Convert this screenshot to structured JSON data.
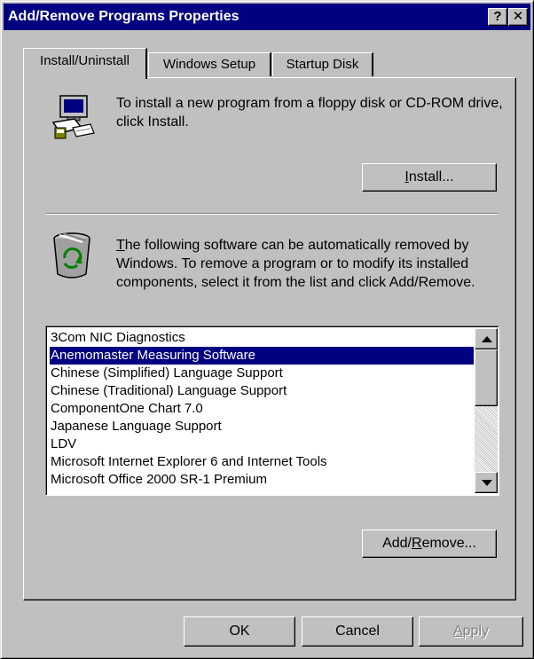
{
  "window": {
    "title": "Add/Remove Programs Properties",
    "help_glyph": "?",
    "close_glyph": "✕"
  },
  "tabs": [
    {
      "label": "Install/Uninstall",
      "active": true
    },
    {
      "label": "Windows Setup",
      "active": false
    },
    {
      "label": "Startup Disk",
      "active": false
    }
  ],
  "install_section": {
    "icon": "setup-program-icon",
    "text": "To install a new program from a floppy disk or CD-ROM drive, click Install.",
    "button": {
      "prefix": "",
      "mnemonic": "I",
      "suffix": "nstall..."
    }
  },
  "remove_section": {
    "icon": "recycle-bin-icon",
    "text_mnemonic": "T",
    "text_rest": "he following software can be automatically removed by Windows. To remove a program or to modify its installed components, select it from the list and click Add/Remove.",
    "list": {
      "items": [
        "3Com NIC Diagnostics",
        "Anemomaster Measuring Software",
        "Chinese (Simplified) Language Support",
        "Chinese (Traditional) Language Support",
        "ComponentOne Chart 7.0",
        "Japanese Language Support",
        "LDV",
        "Microsoft Internet Explorer 6 and Internet Tools",
        "Microsoft Office 2000 SR-1 Premium"
      ],
      "selected_index": 1
    },
    "button": {
      "prefix": "Add/",
      "mnemonic": "R",
      "suffix": "emove..."
    }
  },
  "footer": {
    "ok": "OK",
    "cancel": "Cancel",
    "apply_mnemonic": "A",
    "apply_rest": "pply"
  },
  "colors": {
    "face": "#c0c0c0",
    "titlebar": "#000080",
    "selection": "#000080",
    "disabled_text": "#808080"
  }
}
